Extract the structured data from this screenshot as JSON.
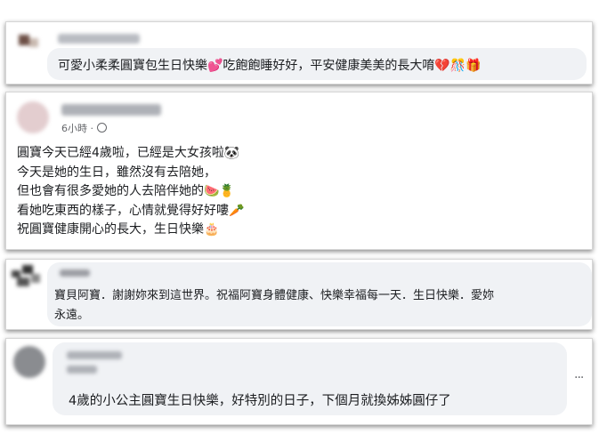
{
  "comment1": {
    "text": "可愛小柔柔圓寶包生日快樂💕吃飽飽睡好好，平安健康美美的長大唷💔🎊🎁"
  },
  "post2": {
    "time": "6小時",
    "time_separator": "·",
    "lines": [
      "圓寶今天已經4歲啦，已經是大女孩啦🐼",
      "今天是她的生日，雖然沒有去陪她，",
      "但也會有很多愛她的人去陪伴她的🍉🍍",
      "看她吃東西的樣子，心情就覺得好好嘍🥕",
      "祝圓寶健康開心的長大，生日快樂🎂"
    ]
  },
  "comment3": {
    "line1": "寶貝阿寶．謝謝妳來到這世界。祝福阿寶身體健康、快樂幸福每一天．生日快樂．愛妳",
    "line2": "永遠。"
  },
  "comment4": {
    "text": "4歲的小公主圓寶生日快樂，好特別的日子，下個月就換姊姊圓仔了",
    "more": "···"
  }
}
